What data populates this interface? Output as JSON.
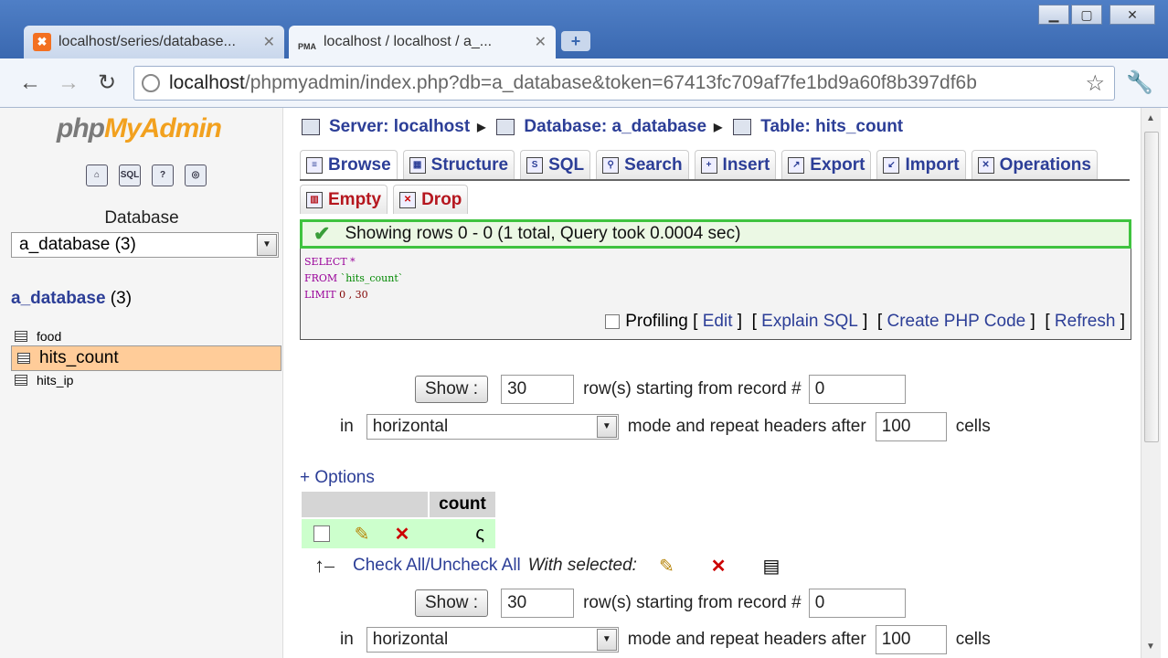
{
  "browser": {
    "tabs": [
      {
        "title": "localhost/series/database...",
        "icon": "xampp-icon"
      },
      {
        "title": "localhost / localhost / a_...",
        "icon": "pma-icon"
      }
    ],
    "url_host": "localhost",
    "url_rest": "/phpmyadmin/index.php?db=a_database&token=67413fc709af7fe1bd9a60f8b397df6b",
    "fav_pma_label": "PMA"
  },
  "sidebar": {
    "logo_part1": "php",
    "logo_part2": "MyAdmin",
    "database_label": "Database",
    "database_select": "a_database (3)",
    "db_name": "a_database",
    "db_count": " (3)",
    "tables": [
      "food",
      "hits_count",
      "hits_ip"
    ],
    "selected_table": "hits_count",
    "quick_icons": [
      "home-icon",
      "sql-query-icon",
      "help-icon",
      "sql-docs-icon"
    ],
    "sql_icon_label": "SQL"
  },
  "breadcrumb": {
    "server": "Server: localhost",
    "database": "Database: a_database",
    "table": "Table: hits_count"
  },
  "tabs_row1": [
    "Browse",
    "Structure",
    "SQL",
    "Search",
    "Insert",
    "Export",
    "Import",
    "Operations"
  ],
  "tabs_row2": [
    "Empty",
    "Drop"
  ],
  "success_message": "Showing rows 0 - 0 (1 total, Query took 0.0004 sec)",
  "sql": {
    "kw_select": "SELECT",
    "select_rest": " *",
    "kw_from": "FROM",
    "from_table": " `hits_count`",
    "kw_limit": "LIMIT",
    "limit_vals": " 0 , 30"
  },
  "sql_links": {
    "profiling": "Profiling",
    "edit": "Edit",
    "explain": "Explain SQL",
    "php_code": "Create PHP Code",
    "refresh": "Refresh"
  },
  "nav_controls": {
    "show_label": "Show :",
    "rows_value": "30",
    "rows_text": "row(s) starting from record #",
    "start_value": "0",
    "in_label": "in",
    "mode_value": "horizontal",
    "mode_text": "mode and repeat headers after",
    "repeat_value": "100",
    "cells_text": "cells"
  },
  "results": {
    "options_label": "+ Options",
    "column_header": "count",
    "row_value": "ς"
  },
  "bulk": {
    "check_all": "Check All",
    "separator": " / ",
    "uncheck_all": "Uncheck All",
    "with_selected": "With selected:"
  }
}
